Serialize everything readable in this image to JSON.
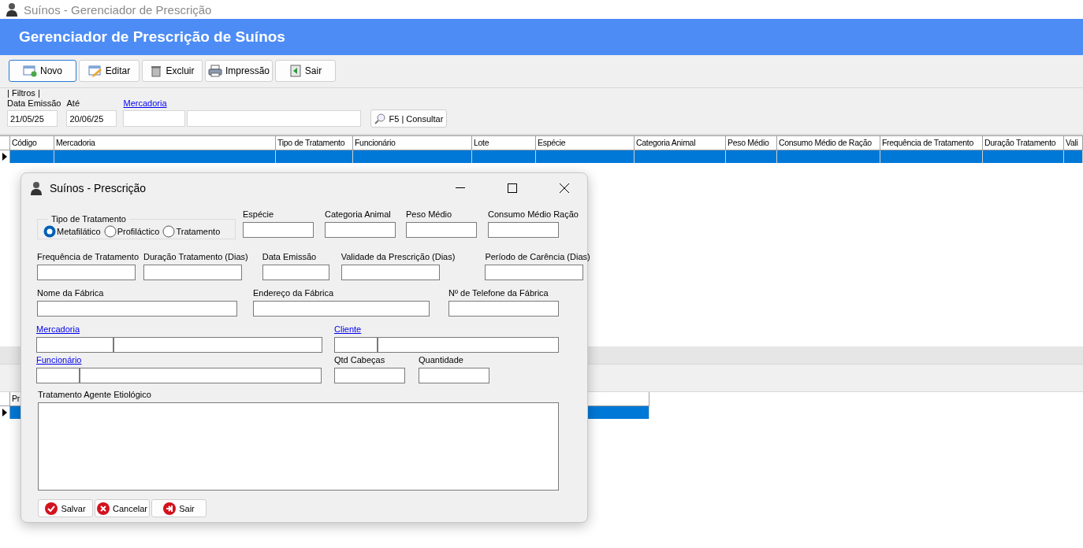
{
  "window": {
    "title": "Suínos - Gerenciador de Prescrição"
  },
  "header": {
    "title": "Gerenciador de Prescrição de Suínos"
  },
  "toolbar": [
    {
      "label": "Novo",
      "kind": "new",
      "selected": true
    },
    {
      "label": "Editar",
      "kind": "edit",
      "selected": false
    },
    {
      "label": "Excluir",
      "kind": "delete",
      "selected": false
    },
    {
      "label": "Impressão",
      "kind": "print",
      "selected": false
    },
    {
      "label": "Sair",
      "kind": "exit",
      "selected": false
    }
  ],
  "filters": {
    "title": "| Filtros |",
    "date_from": {
      "label": "Data Emissão",
      "value": "21/05/25"
    },
    "date_to": {
      "label": "Até",
      "value": "20/06/25"
    },
    "product": {
      "label": "Mercadoria"
    },
    "search_button": "F5 | Consultar"
  },
  "table": {
    "columns": [
      "Código",
      "Mercadoria",
      "Tipo de Tratamento",
      "Funcionário",
      "Lote",
      "Espécie",
      "Categoria Animal",
      "Peso Médio",
      "Consumo Médio de Ração",
      "Frequência de Tratamento",
      "Duração Tratamento",
      "Vali"
    ],
    "rows": [
      {
        "selected": true
      }
    ]
  },
  "detail_table": {
    "columns": [
      "Pr"
    ],
    "rows": [
      {
        "selected": true
      }
    ]
  },
  "dialog": {
    "title": "Suínos - Prescrição",
    "treatment_type": {
      "label": "Tipo de Tratamento",
      "options": [
        {
          "label": "Metafilático",
          "selected": true
        },
        {
          "label": "Profiláctico",
          "selected": false
        },
        {
          "label": "Tratamento",
          "selected": false
        }
      ]
    },
    "fields": [
      {
        "label": "Espécie",
        "kind": "text"
      },
      {
        "label": "Categoria Animal",
        "kind": "text"
      },
      {
        "label": "Peso Médio",
        "kind": "text"
      },
      {
        "label": "Consumo Médio Ração",
        "kind": "text"
      },
      {
        "label": "Frequência de Tratamento",
        "kind": "text"
      },
      {
        "label": "Duração Tratamento (Dias)",
        "kind": "text"
      },
      {
        "label": "Data Emissão",
        "kind": "text"
      },
      {
        "label": "Validade da Prescrição (Dias)",
        "kind": "text"
      },
      {
        "label": "Período de Carência (Dias)",
        "kind": "text"
      },
      {
        "label": "Nome da Fábrica",
        "kind": "text"
      },
      {
        "label": "Endereço da Fábrica",
        "kind": "text"
      },
      {
        "label": "Nº de Telefone da Fábrica",
        "kind": "text"
      },
      {
        "label": "Mercadoria",
        "kind": "lookup"
      },
      {
        "label": "Cliente",
        "kind": "lookup"
      },
      {
        "label": "Funcionário",
        "kind": "lookup"
      },
      {
        "label": "Qtd Cabeças",
        "kind": "text"
      },
      {
        "label": "Quantidade",
        "kind": "text"
      }
    ],
    "memo": {
      "label": "Tratamento Agente Etiológico"
    },
    "buttons": [
      {
        "label": "Salvar",
        "kind": "save"
      },
      {
        "label": "Cancelar",
        "kind": "cancel"
      },
      {
        "label": "Sair",
        "kind": "exit"
      }
    ]
  }
}
